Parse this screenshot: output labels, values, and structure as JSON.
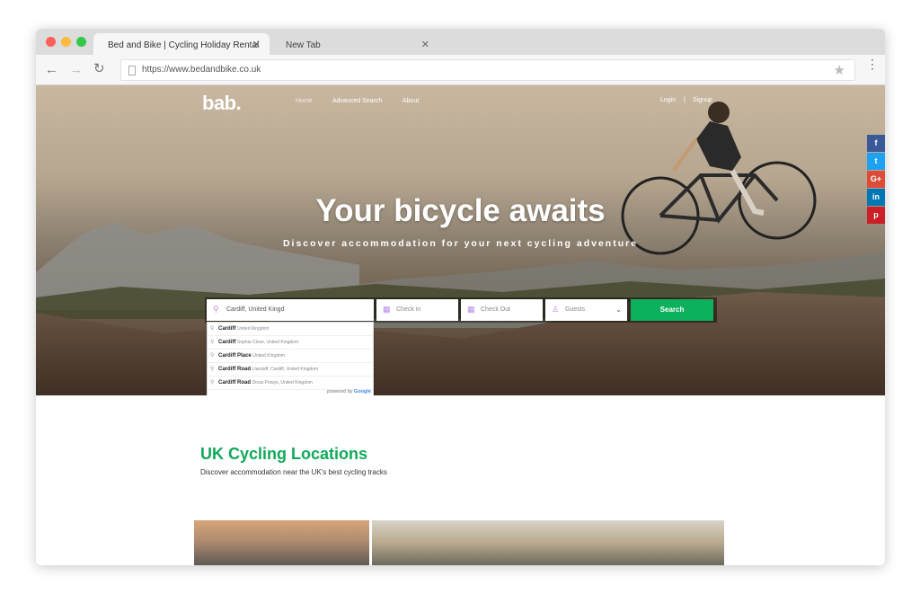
{
  "browser": {
    "tabs": [
      {
        "label": "Bed and Bike | Cycling Holiday Rental",
        "close": "✕"
      },
      {
        "label": "New Tab",
        "close": "✕"
      }
    ],
    "url": "https://www.bedandbike.co.uk",
    "nav": {
      "back": "←",
      "forward": "→",
      "reload": "↻"
    },
    "star": "★",
    "menu": "⋮"
  },
  "site": {
    "logo": "bab.",
    "menu": [
      "Home",
      "Advanced Search",
      "About"
    ],
    "auth": {
      "login": "Login",
      "signup": "Signup"
    },
    "social": [
      {
        "icon": "f",
        "color": "#3b5998"
      },
      {
        "icon": "t",
        "color": "#1da1f2"
      },
      {
        "icon": "G+",
        "color": "#dd4b39"
      },
      {
        "icon": "in",
        "color": "#0077b5"
      },
      {
        "icon": "p",
        "color": "#cb2027"
      }
    ],
    "accent": "#0db15d"
  },
  "hero": {
    "title": "Your bicycle awaits",
    "subtitle": "Discover accommodation for your next cycling adventure"
  },
  "search": {
    "location_value": "Cardiff, United Kingd",
    "check_in": "Check in",
    "check_out": "Check Out",
    "guests": "Guests",
    "button": "Search"
  },
  "autocomplete": {
    "items": [
      {
        "main": "Cardiff",
        "secondary": "United Kingdom"
      },
      {
        "main": "Cardiff",
        "secondary": "Sophia Close, United Kingdom"
      },
      {
        "main": "Cardiff Place",
        "secondary": "United Kingdom"
      },
      {
        "main": "Cardiff Road",
        "secondary": "Llandaff, Cardiff, United Kingdom"
      },
      {
        "main": "Cardiff Road",
        "secondary": "Dinas Powys, United Kingdom"
      }
    ],
    "powered_by": "powered by",
    "google": "Google"
  },
  "section": {
    "title": "UK Cycling Locations",
    "subtitle": "Discover accommodation near the UK's best cycling tracks"
  }
}
